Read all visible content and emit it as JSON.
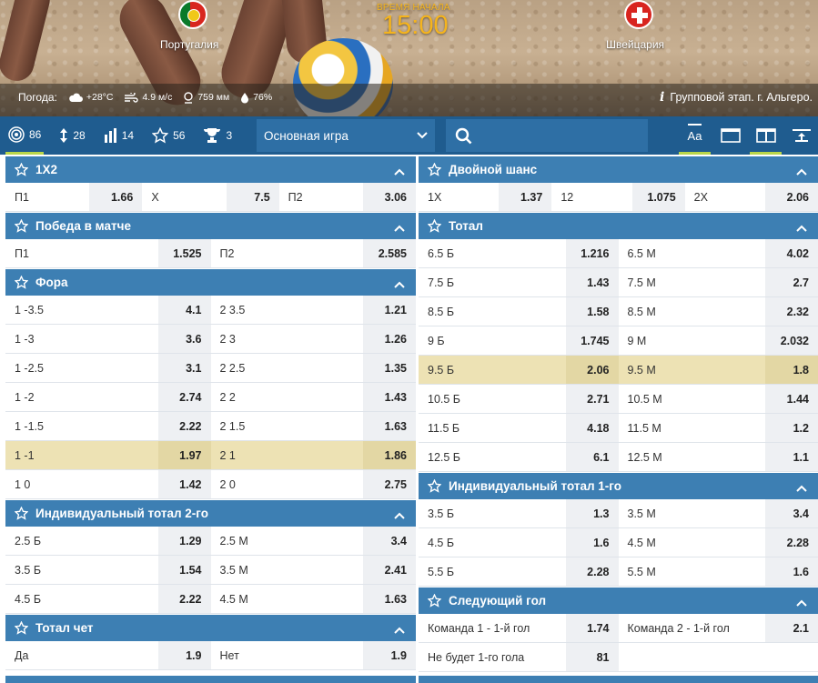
{
  "match": {
    "home_team": "Португалия",
    "away_team": "Швейцария",
    "kickoff_label": "ВРЕМЯ НАЧАЛА",
    "kickoff_time": "15:00",
    "weather_label": "Погода:",
    "temperature": "+28°C",
    "wind": "4.9 м/с",
    "pressure": "759 мм",
    "humidity": "76%",
    "stage": "Групповой этап. г. Альгеро."
  },
  "toolbar": {
    "counters": [
      {
        "icon": "target-icon",
        "value": "86"
      },
      {
        "icon": "updown-icon",
        "value": "28"
      },
      {
        "icon": "bars-icon",
        "value": "14"
      },
      {
        "icon": "star-icon",
        "value": "56"
      },
      {
        "icon": "trophy-icon",
        "value": "3"
      }
    ],
    "select_value": "Основная игра",
    "font_button_label": "Aa"
  },
  "markets_left": [
    {
      "title": "1X2",
      "rows": [
        {
          "cells": [
            [
              "П1",
              "1.66"
            ],
            [
              "X",
              "7.5"
            ],
            [
              "П2",
              "3.06"
            ]
          ]
        }
      ]
    },
    {
      "title": "Победа в матче",
      "rows": [
        {
          "cells": [
            [
              "П1",
              "1.525"
            ],
            [
              "П2",
              "2.585"
            ]
          ]
        }
      ]
    },
    {
      "title": "Фора",
      "rows": [
        {
          "cells": [
            [
              "1 -3.5",
              "4.1"
            ],
            [
              "2 3.5",
              "1.21"
            ]
          ]
        },
        {
          "cells": [
            [
              "1 -3",
              "3.6"
            ],
            [
              "2 3",
              "1.26"
            ]
          ]
        },
        {
          "cells": [
            [
              "1 -2.5",
              "3.1"
            ],
            [
              "2 2.5",
              "1.35"
            ]
          ]
        },
        {
          "cells": [
            [
              "1 -2",
              "2.74"
            ],
            [
              "2 2",
              "1.43"
            ]
          ]
        },
        {
          "cells": [
            [
              "1 -1.5",
              "2.22"
            ],
            [
              "2 1.5",
              "1.63"
            ]
          ]
        },
        {
          "cells": [
            [
              "1 -1",
              "1.97"
            ],
            [
              "2 1",
              "1.86"
            ]
          ],
          "highlight": true
        },
        {
          "cells": [
            [
              "1 0",
              "1.42"
            ],
            [
              "2 0",
              "2.75"
            ]
          ]
        }
      ]
    },
    {
      "title": "Индивидуальный тотал 2-го",
      "rows": [
        {
          "cells": [
            [
              "2.5 Б",
              "1.29"
            ],
            [
              "2.5 М",
              "3.4"
            ]
          ]
        },
        {
          "cells": [
            [
              "3.5 Б",
              "1.54"
            ],
            [
              "3.5 М",
              "2.41"
            ]
          ]
        },
        {
          "cells": [
            [
              "4.5 Б",
              "2.22"
            ],
            [
              "4.5 М",
              "1.63"
            ]
          ]
        }
      ]
    },
    {
      "title": "Тотал чет",
      "rows": [
        {
          "cells": [
            [
              "Да",
              "1.9"
            ],
            [
              "Нет",
              "1.9"
            ]
          ]
        }
      ]
    }
  ],
  "markets_right": [
    {
      "title": "Двойной шанс",
      "rows": [
        {
          "cells": [
            [
              "1X",
              "1.37"
            ],
            [
              "12",
              "1.075"
            ],
            [
              "2X",
              "2.06"
            ]
          ]
        }
      ]
    },
    {
      "title": "Тотал",
      "rows": [
        {
          "cells": [
            [
              "6.5 Б",
              "1.216"
            ],
            [
              "6.5 М",
              "4.02"
            ]
          ]
        },
        {
          "cells": [
            [
              "7.5 Б",
              "1.43"
            ],
            [
              "7.5 М",
              "2.7"
            ]
          ]
        },
        {
          "cells": [
            [
              "8.5 Б",
              "1.58"
            ],
            [
              "8.5 М",
              "2.32"
            ]
          ]
        },
        {
          "cells": [
            [
              "9 Б",
              "1.745"
            ],
            [
              "9 М",
              "2.032"
            ]
          ]
        },
        {
          "cells": [
            [
              "9.5 Б",
              "2.06"
            ],
            [
              "9.5 М",
              "1.8"
            ]
          ],
          "highlight": true
        },
        {
          "cells": [
            [
              "10.5 Б",
              "2.71"
            ],
            [
              "10.5 М",
              "1.44"
            ]
          ]
        },
        {
          "cells": [
            [
              "11.5 Б",
              "4.18"
            ],
            [
              "11.5 М",
              "1.2"
            ]
          ]
        },
        {
          "cells": [
            [
              "12.5 Б",
              "6.1"
            ],
            [
              "12.5 М",
              "1.1"
            ]
          ]
        }
      ]
    },
    {
      "title": "Индивидуальный тотал 1-го",
      "rows": [
        {
          "cells": [
            [
              "3.5 Б",
              "1.3"
            ],
            [
              "3.5 М",
              "3.4"
            ]
          ]
        },
        {
          "cells": [
            [
              "4.5 Б",
              "1.6"
            ],
            [
              "4.5 М",
              "2.28"
            ]
          ]
        },
        {
          "cells": [
            [
              "5.5 Б",
              "2.28"
            ],
            [
              "5.5 М",
              "1.6"
            ]
          ]
        }
      ]
    },
    {
      "title": "Следующий гол",
      "rows": [
        {
          "cells": [
            [
              "Команда 1 - 1-й гол",
              "1.74"
            ],
            [
              "Команда 2 - 1-й гол",
              "2.1"
            ]
          ]
        },
        {
          "cells": [
            [
              "Не будет 1-го гола",
              "81"
            ]
          ]
        }
      ]
    }
  ]
}
